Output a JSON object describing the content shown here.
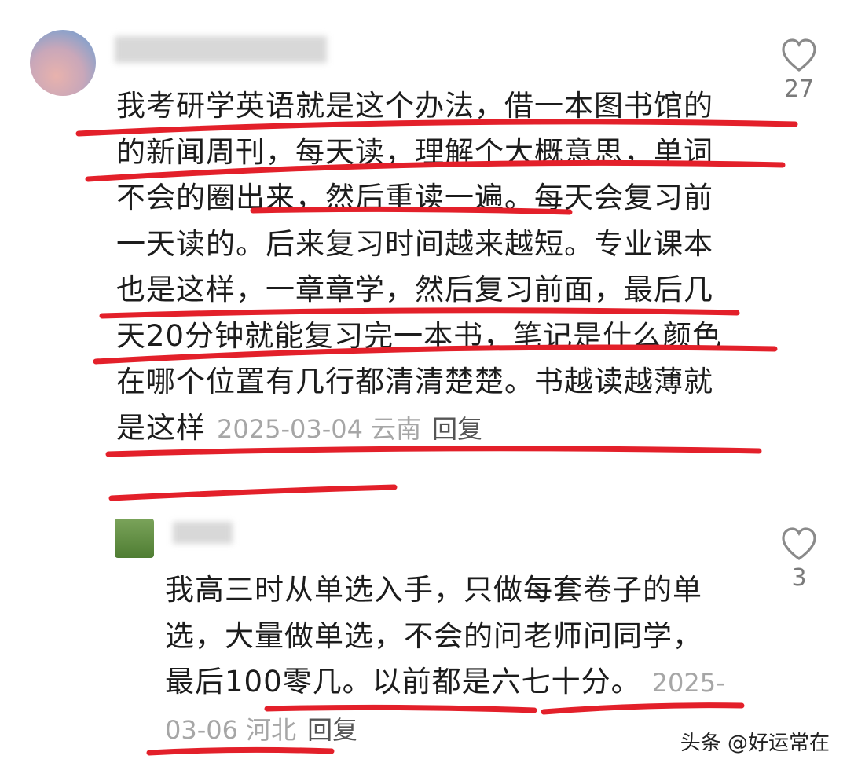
{
  "comments": [
    {
      "text": "我考研学英语就是这个办法，借一本图书馆的的新闻周刊，每天读，理解个大概意思，单词不会的圈出来，然后重读一遍。每天会复习前一天读的。后来复习时间越来越短。专业课本也是这样，一章章学，然后复习前面，最后几天20分钟就能复习完一本书，笔记是什么颜色在哪个位置有几行都清清楚楚。书越读越薄就是这样",
      "date": "2025-03-04",
      "location": "云南",
      "reply_label": "回复",
      "likes": "27",
      "like_icon": "heart-outline-icon"
    },
    {
      "text": "我高三时从单选入手，只做每套卷子的单选，大量做单选，不会的问老师问同学，最后100零几。以前都是六七十分。",
      "date": "2025-03-06",
      "location": "河北",
      "reply_label": "回复",
      "likes": "3",
      "like_icon": "heart-outline-icon"
    }
  ],
  "watermark": "头条 @好运常在",
  "colors": {
    "underline": "#e3202a",
    "meta": "#a6a6a6"
  }
}
